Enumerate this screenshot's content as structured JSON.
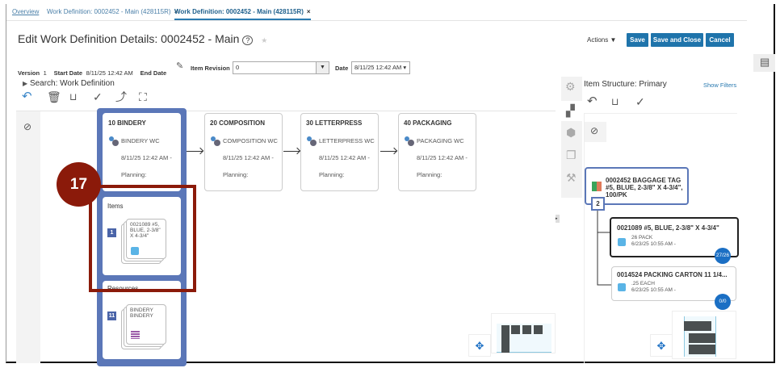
{
  "tabs": {
    "overview": "Overview",
    "tab1": "Work Definition: 0002452 - Main (428115R)",
    "tab2": "Work Definition: 0002452 - Main (428115R)",
    "close": "×"
  },
  "page": {
    "title": "Edit Work Definition Details: 0002452 - Main",
    "help": "?",
    "star": "★"
  },
  "actions": {
    "menu": "Actions ▼",
    "save": "Save",
    "save_close": "Save and Close",
    "cancel": "Cancel"
  },
  "header": {
    "version_label": "Version",
    "version": "1",
    "start_label": "Start Date",
    "start": "8/11/25 12:42 AM",
    "end_label": "End Date",
    "item_rev_label": "Item Revision",
    "item_rev": "0",
    "date_label": "Date",
    "date": "8/11/25 12:42 AM"
  },
  "search": {
    "label": "Search: Work Definition"
  },
  "operations": [
    {
      "title": "10 BINDERY",
      "wc": "BINDERY WC",
      "date": "8/11/25 12:42 AM -",
      "planning": "Planning:"
    },
    {
      "title": "20 COMPOSITION",
      "wc": "COMPOSITION WC",
      "date": "8/11/25 12:42 AM -",
      "planning": "Planning:"
    },
    {
      "title": "30 LETTERPRESS",
      "wc": "LETTERPRESS WC",
      "date": "8/11/25 12:42 AM -",
      "planning": "Planning:"
    },
    {
      "title": "40 PACKAGING",
      "wc": "PACKAGING WC",
      "date": "8/11/25 12:42 AM -",
      "planning": "Planning:"
    }
  ],
  "items": {
    "label": "Items",
    "count": "1",
    "item": "0021089 #5, BLUE, 2-3/8\" X 4-3/4\""
  },
  "resources": {
    "label": "Resources",
    "count": "11",
    "name": "BINDERY",
    "desc": "BINDERY"
  },
  "callout": {
    "number": "17",
    "color": "#8b1a0a"
  },
  "structure": {
    "title": "Item Structure: Primary",
    "show_filters": "Show Filters",
    "root": "0002452 BAGGAGE TAG #5, BLUE, 2-3/8\" X 4-3/4\", 100/PK",
    "child_count": "2",
    "children": [
      {
        "name": "0021089 #5, BLUE, 2-3/8\" X 4-3/4\"",
        "qty": "26 PACK",
        "date": "6/23/25 10:55 AM -",
        "badge": "27/26"
      },
      {
        "name": "0014524 PACKING CARTON 11 1/4...",
        "qty": ".25 EACH",
        "date": "6/23/25 10:55 AM -",
        "badge": "0/0"
      }
    ]
  }
}
